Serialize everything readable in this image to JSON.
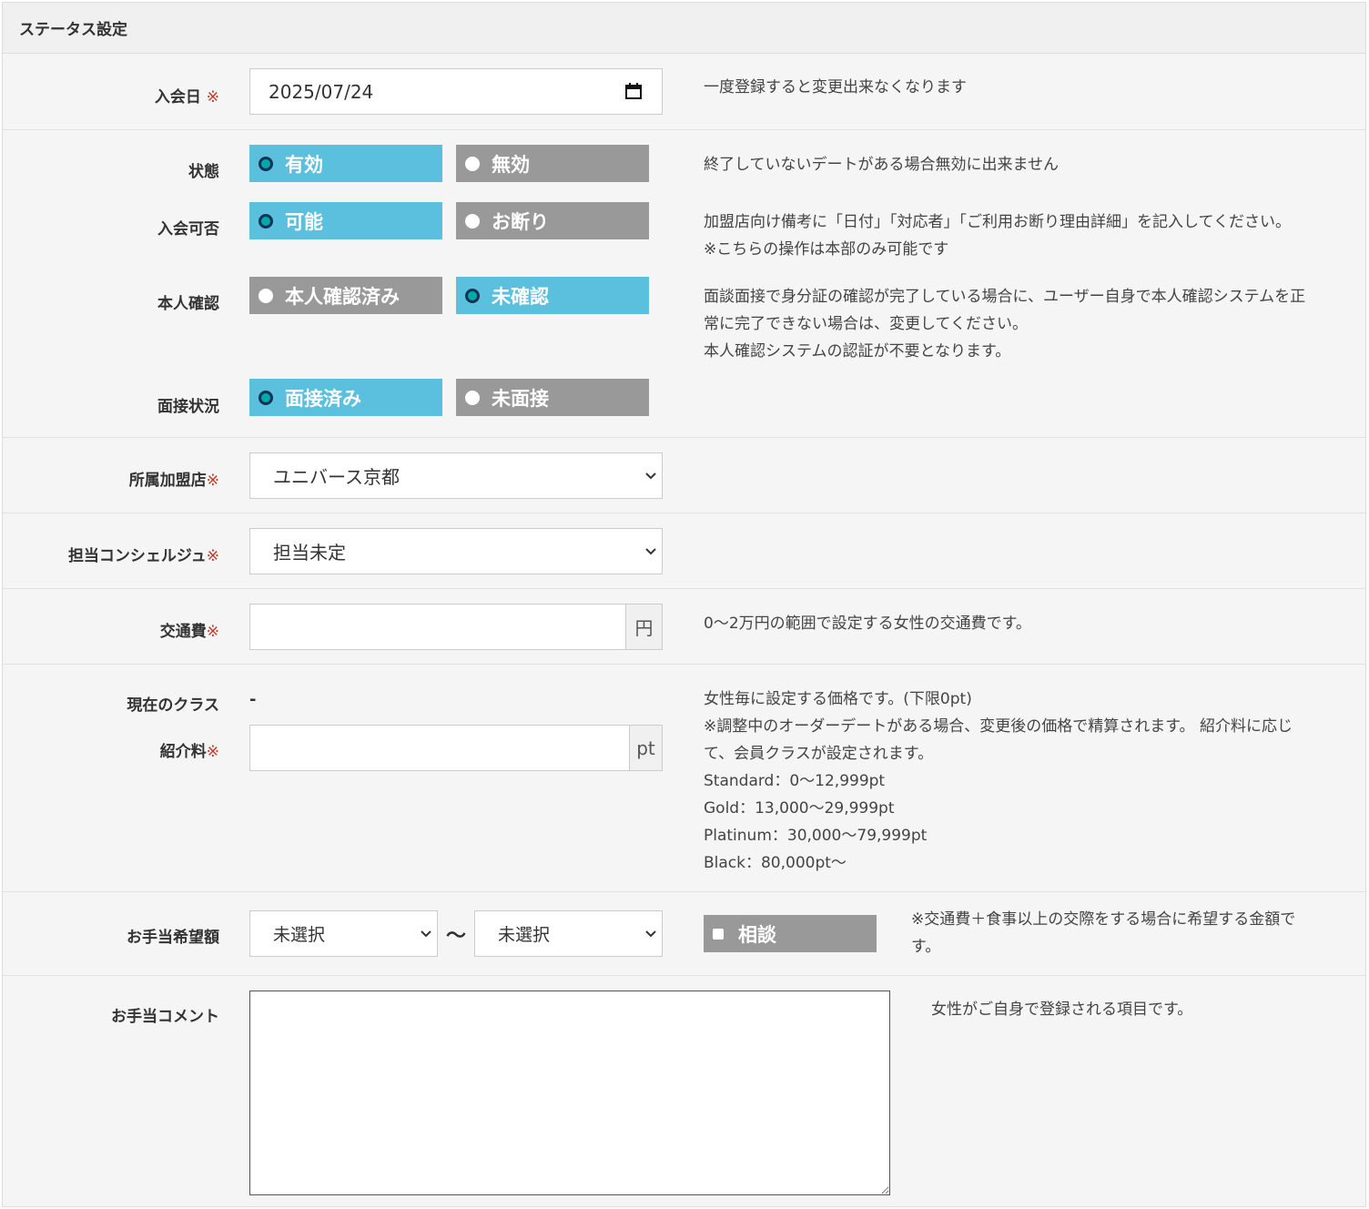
{
  "panel": {
    "title": "ステータス設定"
  },
  "required_mark": "※",
  "join_date": {
    "label": "入会日",
    "value": "2025/07/24",
    "note": "一度登録すると変更出来なくなります"
  },
  "status": {
    "label": "状態",
    "options": [
      "有効",
      "無効"
    ],
    "selected": "有効",
    "note": "終了していないデートがある場合無効に出来ません"
  },
  "admission": {
    "label": "入会可否",
    "options": [
      "可能",
      "お断り"
    ],
    "selected": "可能",
    "note_lines": [
      "加盟店向け備考に「日付」「対応者」「ご利用お断り理由詳細」を記入してください。",
      "※こちらの操作は本部のみ可能です"
    ]
  },
  "identity": {
    "label": "本人確認",
    "options": [
      "本人確認済み",
      "未確認"
    ],
    "selected": "未確認",
    "note_lines": [
      "面談面接で身分証の確認が完了している場合に、ユーザー自身で本人確認システムを正",
      "常に完了できない場合は、変更してください。",
      "本人確認システムの認証が不要となります。"
    ]
  },
  "interview": {
    "label": "面接状況",
    "options": [
      "面接済み",
      "未面接"
    ],
    "selected": "面接済み"
  },
  "store": {
    "label": "所属加盟店",
    "value": "ユニバース京都"
  },
  "concierge": {
    "label": "担当コンシェルジュ",
    "value": "担当未定"
  },
  "transport": {
    "label": "交通費",
    "value": "",
    "unit": "円",
    "note": "0〜2万円の範囲で設定する女性の交通費です。"
  },
  "class": {
    "label": "現在のクラス",
    "value": "-",
    "fee_label": "紹介料",
    "fee_value": "",
    "fee_unit": "pt",
    "note_lines": [
      "女性毎に設定する価格です。(下限0pt)",
      "※調整中のオーダーデートがある場合、変更後の価格で精算されます。 紹介料に応じ",
      "て、会員クラスが設定されます。",
      "Standard：0〜12,999pt",
      "Gold：13,000〜29,999pt",
      "Platinum：30,000〜79,999pt",
      "Black：80,000pt〜"
    ]
  },
  "allowance": {
    "label": "お手当希望額",
    "min": "未選択",
    "max": "未選択",
    "separator": "〜",
    "consult_label": "相談",
    "note_lines": [
      "※交通費＋食事以上の交際をする場合に希望する金額で",
      "す。"
    ]
  },
  "comment": {
    "label": "お手当コメント",
    "value": "",
    "note": "女性がご自身で登録される項目です。"
  }
}
